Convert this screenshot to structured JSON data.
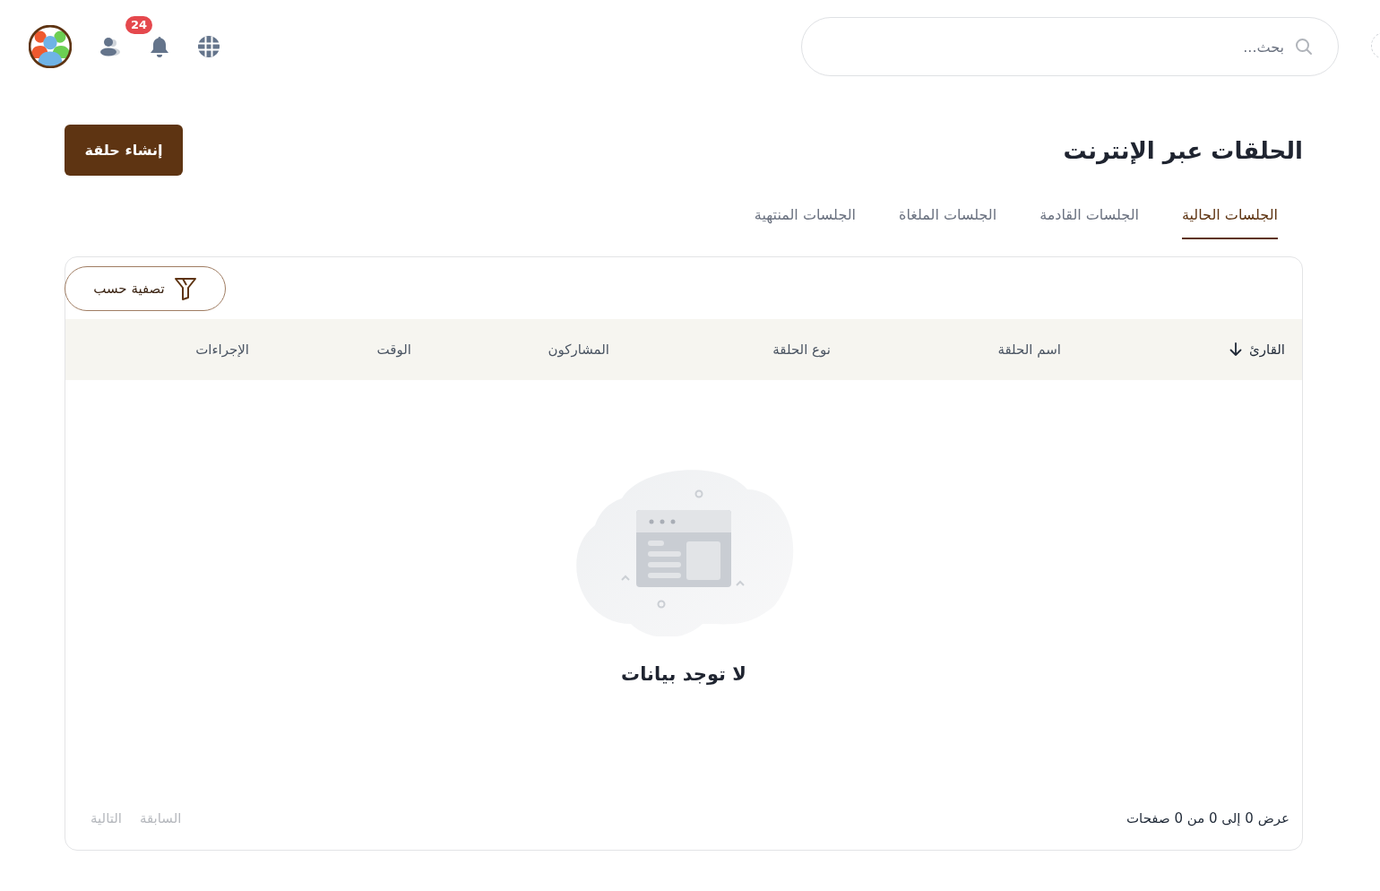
{
  "header": {
    "search": {
      "placeholder": "بحث..."
    },
    "notifications": {
      "count": "24"
    }
  },
  "page": {
    "title": "الحلقات عبر الإنترنت",
    "create_button": "إنشاء حلقة"
  },
  "tabs": [
    {
      "label": "الجلسات الحالية",
      "selected": true
    },
    {
      "label": "الجلسات القادمة",
      "selected": false
    },
    {
      "label": "الجلسات الملغاة",
      "selected": false
    },
    {
      "label": "الجلسات المنتهية",
      "selected": false
    }
  ],
  "table": {
    "filter_button": "تصفية حسب",
    "columns": [
      {
        "label": "القارئ",
        "sorted": true
      },
      {
        "label": "اسم الحلقة",
        "sorted": false
      },
      {
        "label": "نوع الحلقة",
        "sorted": false
      },
      {
        "label": "المشاركون",
        "sorted": false
      },
      {
        "label": "الوقت",
        "sorted": false
      },
      {
        "label": "الإجراءات",
        "sorted": false
      }
    ],
    "empty_message": "لا توجد بيانات",
    "page_info": "عرض 0 إلى 0 من 0 صفحات",
    "pagination": [
      {
        "label": "السابقة",
        "disabled": true
      },
      {
        "label": "التالية",
        "disabled": true
      }
    ]
  }
}
